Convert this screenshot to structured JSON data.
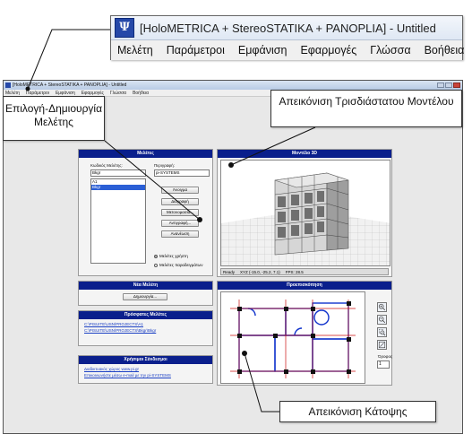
{
  "zoom": {
    "title": "[HoloMETRICA + StereoSTATIKA + PANOPLIA] - Untitled",
    "menu": [
      "Μελέτη",
      "Παράμετροι",
      "Εμφάνιση",
      "Εφαρμογές",
      "Γλώσσα",
      "Βοήθεια"
    ]
  },
  "app": {
    "title": "[HoloMETRICA + StereoSTATIKA + PANOPLIA] - Untitled",
    "menu": [
      "Μελέτη",
      "Παράμετροι",
      "Εμφάνιση",
      "Εφαρμογές",
      "Γλώσσα",
      "Βοήθεια"
    ]
  },
  "study_panel": {
    "header": "Μελέτες",
    "code_label": "Κωδικός Μελέτης:",
    "code_value": "Bkgr",
    "desc_label": "Περιγραφή:",
    "desc_value": "pi-SYSTEMS",
    "list": [
      "A1",
      "Bkgr"
    ],
    "selected": "Bkgr",
    "buttons": [
      "Άνοιγμα",
      "Διαγραφή",
      "Μετονομασία...",
      "Αντιγραφή...",
      "Ανανέωση"
    ],
    "radio_user": "Μελέτες χρήστη",
    "radio_examples": "Μελέτες παραδειγμάτων"
  },
  "new_panel": {
    "header": "Νέα Μελέτη",
    "button": "Δημιουργία..."
  },
  "recent_panel": {
    "header": "Πρόσφατες Μελέτες",
    "items": [
      "C:\\PISUITE\\USN\\PROJECTS\\A1",
      "C:\\PISUITE\\USN\\PROJECTS\\Bkgr\\Bkgr"
    ]
  },
  "links_panel": {
    "header": "Χρήσιμοι Σύνδεσμοι",
    "items": [
      "Διαδικτυακός χώρος www.pi.gr",
      "Επικοινωνήστε μέσω e-mail με την pi-SYSTEMS"
    ]
  },
  "model_panel": {
    "header": "Μοντέλο 3D",
    "status": [
      "Ready",
      "XYZ (-15.0, -25.2, 7.1)",
      "FPS: 28.5"
    ]
  },
  "plan_panel": {
    "header": "Προεπισκόπηση",
    "floor_label": "Όροφος",
    "floor_value": "1"
  },
  "callouts": {
    "select_study": "Επιλογή-Δημιουργία Μελέτης",
    "model_3d": "Απεικόνιση Τρισδιάστατου Μοντέλου",
    "floor_plan": "Απεικόνιση Κάτοψης"
  },
  "colors": {
    "panel_header": "#0a1f8c",
    "accent": "#2b5fd6",
    "plan_red": "#cc1111",
    "plan_blue": "#1133cc"
  }
}
